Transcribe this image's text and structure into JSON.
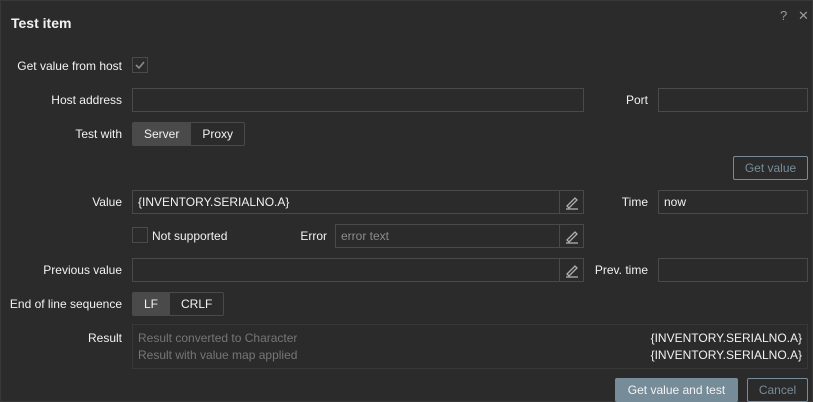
{
  "dialog": {
    "title": "Test item",
    "help_glyph": "?",
    "close_glyph": "✕"
  },
  "form": {
    "get_value_from_host": {
      "label": "Get value from host",
      "checked": true
    },
    "host_address": {
      "label": "Host address",
      "value": ""
    },
    "port": {
      "label": "Port",
      "value": ""
    },
    "test_with": {
      "label": "Test with",
      "options": [
        "Server",
        "Proxy"
      ],
      "selected": "Server"
    },
    "get_value_button": "Get value",
    "value": {
      "label": "Value",
      "value": "{INVENTORY.SERIALNO.A}"
    },
    "time": {
      "label": "Time",
      "value": "now"
    },
    "not_supported": {
      "label": "Not supported",
      "checked": false
    },
    "error": {
      "label": "Error",
      "placeholder": "error text"
    },
    "previous_value": {
      "label": "Previous value",
      "value": ""
    },
    "prev_time": {
      "label": "Prev. time",
      "value": ""
    },
    "eol": {
      "label": "End of line sequence",
      "options": [
        "LF",
        "CRLF"
      ],
      "selected": "LF"
    },
    "result": {
      "label": "Result",
      "rows": [
        {
          "label": "Result converted to Character",
          "value": "{INVENTORY.SERIALNO.A}"
        },
        {
          "label": "Result with value map applied",
          "value": "{INVENTORY.SERIALNO.A}"
        }
      ]
    }
  },
  "footer": {
    "primary": "Get value and test",
    "cancel": "Cancel"
  },
  "colors": {
    "background": "#2b2b2b",
    "border": "#4a4a4a",
    "accent": "#768d99",
    "muted_text": "#767676"
  },
  "icons": {
    "pencil": "pencil-icon",
    "check": "check-icon",
    "help": "help-icon",
    "close": "close-icon"
  }
}
